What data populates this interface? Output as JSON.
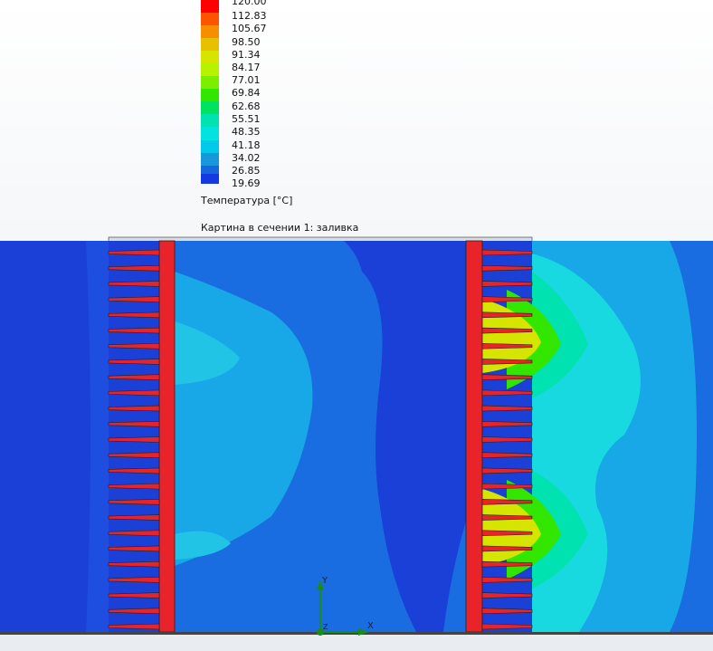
{
  "legend": {
    "title": "Температура [°C]",
    "colors": [
      "#fe0000",
      "#fc5400",
      "#f58f00",
      "#e7c000",
      "#d5e500",
      "#b7f200",
      "#7eee00",
      "#33e600",
      "#00e260",
      "#00e2b0",
      "#00e3e0",
      "#00c8e8",
      "#1898d8",
      "#1467dc",
      "#1638e0"
    ],
    "ticks": [
      "120.00",
      "112.83",
      "105.67",
      "98.50",
      "91.34",
      "84.17",
      "77.01",
      "69.84",
      "62.68",
      "55.51",
      "48.35",
      "41.18",
      "34.02",
      "26.85",
      "19.69"
    ]
  },
  "cut_plot": {
    "title": "Картина в сечении 1: заливка"
  },
  "axes": {
    "x": "X",
    "y": "Y",
    "z": "Z"
  },
  "colors": {
    "fin": "#e8232a",
    "cold_region": "#1a40d8",
    "mid_region": "#1a6de0",
    "warm_region": "#18a8e8",
    "hot_region": "#18d8e0"
  }
}
